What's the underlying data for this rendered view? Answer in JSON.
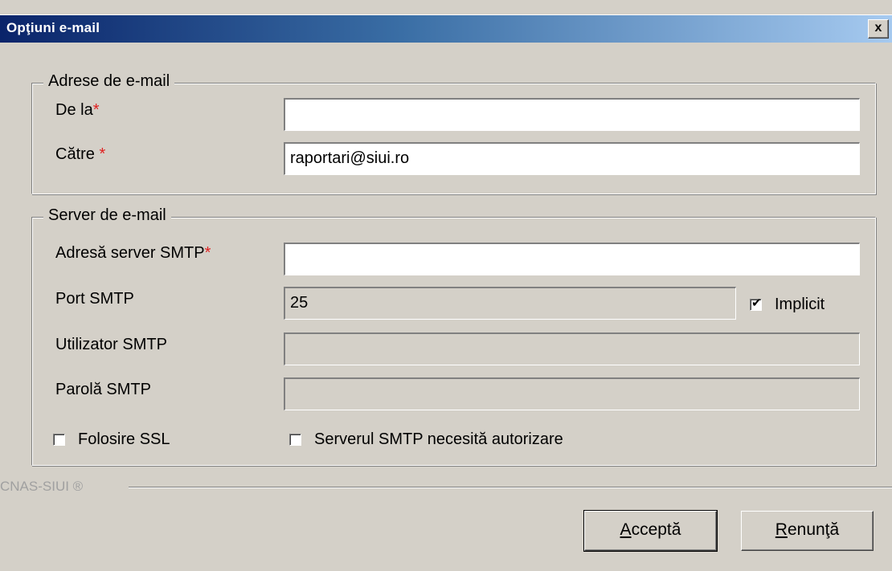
{
  "window": {
    "title": "Opţiuni e-mail",
    "close_label": "x"
  },
  "email_group": {
    "title": "Adrese de e-mail",
    "from_label": "De la",
    "to_label": "Către",
    "required_mark": "*",
    "from_value": "",
    "to_value": "raportari@siui.ro"
  },
  "server_group": {
    "title": "Server de e-mail",
    "smtp_address_label": "Adresă server SMTP",
    "smtp_address_value": "",
    "port_label": "Port SMTP",
    "port_value": "25",
    "default_label": "Implicit",
    "user_label": "Utilizator SMTP",
    "user_value": "",
    "password_label": "Parolă SMTP",
    "password_value": "",
    "ssl_label": "Folosire SSL",
    "auth_label": "Serverul SMTP necesită autorizare"
  },
  "footer": {
    "brand": "CNAS-SIUI ®"
  },
  "buttons": {
    "accept_mnemonic": "A",
    "accept_rest": "cceptă",
    "cancel_mnemonic": "R",
    "cancel_rest": "enunţă"
  }
}
